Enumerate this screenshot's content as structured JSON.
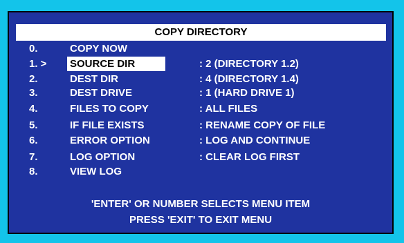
{
  "title": "COPY DIRECTORY",
  "selected_index": 1,
  "items": [
    {
      "num": "0.",
      "label": "COPY NOW",
      "value": ""
    },
    {
      "num": "1. >",
      "label": "SOURCE DIR",
      "value": ": 2 (DIRECTORY 1.2)"
    },
    {
      "num": "2.",
      "label": "DEST DIR",
      "value": ": 4 (DIRECTORY 1.4)"
    },
    {
      "num": "3.",
      "label": "DEST DRIVE",
      "value": ": 1 (HARD DRIVE 1)"
    },
    {
      "num": "4.",
      "label": "FILES TO COPY",
      "value": ": ALL FILES"
    },
    {
      "num": "5.",
      "label": "IF FILE EXISTS",
      "value": ": RENAME COPY OF FILE"
    },
    {
      "num": "6.",
      "label": "ERROR OPTION",
      "value": ": LOG AND CONTINUE"
    },
    {
      "num": "7.",
      "label": "LOG OPTION",
      "value": ": CLEAR LOG FIRST"
    },
    {
      "num": "8.",
      "label": "VIEW LOG",
      "value": ""
    }
  ],
  "footer": {
    "line1": "'ENTER' OR NUMBER SELECTS MENU ITEM",
    "line2": "PRESS 'EXIT' TO EXIT MENU"
  },
  "colors": {
    "outer_background": "#13c4ea",
    "panel_background": "#1f33a0",
    "text": "#ffffff",
    "highlight_background": "#ffffff",
    "highlight_text": "#000000"
  }
}
